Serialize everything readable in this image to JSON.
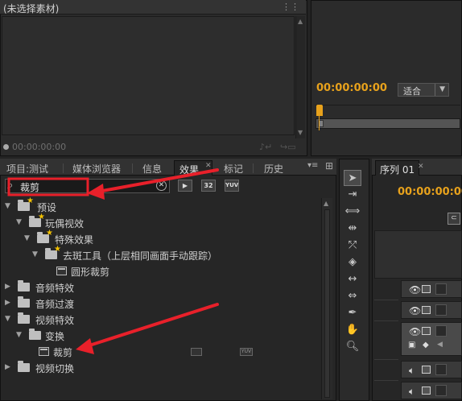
{
  "source_monitor": {
    "title": "(未选择素材)",
    "timecode": "00:00:00:00"
  },
  "program_monitor": {
    "timecode": "00:00:00:00",
    "zoom_select": "适合"
  },
  "tabs": [
    {
      "label": "项目:测试"
    },
    {
      "label": "媒体浏览器"
    },
    {
      "label": "信息"
    },
    {
      "label": "效果"
    },
    {
      "label": "标记"
    },
    {
      "label": "历史"
    }
  ],
  "search": {
    "value": "裁剪"
  },
  "filter_buttons": [
    "32",
    "YUV"
  ],
  "tree": [
    {
      "label": "预设"
    },
    {
      "label": "玩偶视效"
    },
    {
      "label": "特殊效果"
    },
    {
      "label": "去斑工具（上层相同画面手动跟踪）"
    },
    {
      "label": "圆形裁剪"
    },
    {
      "label": "音频特效"
    },
    {
      "label": "音频过渡"
    },
    {
      "label": "视频特效"
    },
    {
      "label": "变换"
    },
    {
      "label": "裁剪"
    },
    {
      "label": "视频切换"
    }
  ],
  "sequence": {
    "tab_label": "序列 01",
    "timecode": "00:00:00:00"
  },
  "colors": {
    "accent": "#e8a21c",
    "annotation": "#e8202a"
  },
  "icons": {
    "tools": [
      "selection-tool-icon",
      "track-select-icon",
      "ripple-edit-icon",
      "rolling-edit-icon",
      "rate-stretch-icon",
      "razor-icon",
      "slip-icon",
      "slide-icon",
      "pen-icon",
      "hand-icon",
      "zoom-icon"
    ]
  }
}
